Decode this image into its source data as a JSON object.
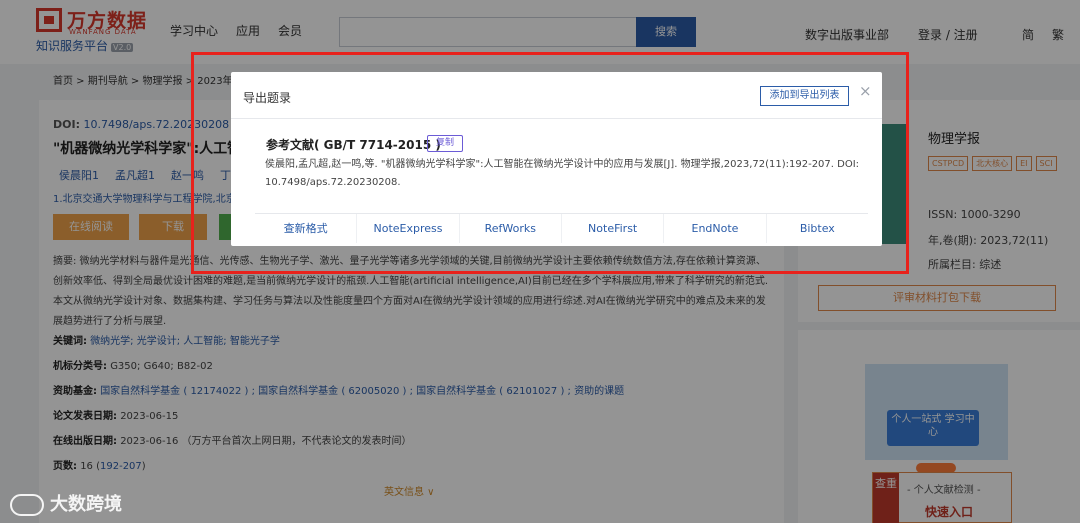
{
  "header": {
    "logo_cn": "万方数据",
    "logo_en": "WANFANG DATA",
    "logo_sub": "知识服务平台",
    "logo_version": "V2.0",
    "nav": [
      "学习中心",
      "应用",
      "会员"
    ],
    "search_button": "搜索",
    "digital_publishing": "数字出版事业部",
    "login": "登录 / 注册",
    "lang_simplified": "简",
    "lang_traditional": "繁"
  },
  "breadcrumb": "首页 > 期刊导航 > 物理学报 > 2023年",
  "article": {
    "doi_label": "DOI:",
    "doi_value": "10.7498/aps.72.20230208",
    "title": "\"机器微纳光学科学家\":人工智",
    "authors": [
      "侯晨阳1",
      "孟凡超1",
      "赵一鸣",
      "丁讯"
    ],
    "affiliation": "1.北京交通大学物理科学与工程学院,北京",
    "btn_read": "在线阅读",
    "btn_download": "下载",
    "abstract": "摘要: 微纳光学材料与器件是光通信、光传感、生物光子学、激光、量子光学等诸多光学领域的关键,目前微纳光学设计主要依赖传统数值方法,存在依赖计算资源、创新效率低、得到全局最优设计困难的难题,是当前微纳光学设计的瓶颈.人工智能(artificial intelligence,AI)目前已经在多个学科展应用,带来了科学研究的新范式.本文从微纳光学设计对象、数据集构建、学习任务与算法以及性能度量四个方面对AI在微纳光学设计领域的应用进行综述.对AI在微纳光学研究中的难点及未来的发展趋势进行了分析与展望.",
    "keywords_label": "关键词:",
    "keywords": "微纳光学; 光学设计; 人工智能; 智能光子学",
    "class_label": "机标分类号:",
    "class_value": "G350; G640; B82-02",
    "fund_label": "资助基金:",
    "fund_value": "国家自然科学基金 ( 12174022 ) ; 国家自然科学基金 ( 62005020 ) ; 国家自然科学基金 ( 62101027 ) ; 资助的课题",
    "pubdate_label": "论文发表日期:",
    "pubdate_value": "2023-06-15",
    "online_label": "在线出版日期:",
    "online_value": "2023-06-16 （万方平台首次上网日期，不代表论文的发表时间）",
    "pages_label": "页数:",
    "pages_value": "16 (",
    "pages_range": "192-207",
    "pages_end": ")",
    "expand": "英文信息 ∨"
  },
  "side": {
    "journal": "物理学报",
    "tags": [
      "CSTPCD",
      "北大核心",
      "EI",
      "SCI"
    ],
    "issn": "ISSN: 1000-3290",
    "volume": "年,卷(期): 2023,72(11)",
    "column": "所属栏目: 综述",
    "pack_download": "评审材料打包下载",
    "promo_text": "个人一站式 学习中心",
    "detect_side": "查重",
    "detect_title": "- 个人文献检测 -",
    "detect_entry": "快速入口"
  },
  "dialog": {
    "title": "导出题录",
    "add_button": "添加到导出列表",
    "close": "×",
    "ref_label": "参考文献( GB/T 7714-2015 )",
    "copy_button": "复制",
    "ref_text": "侯晨阳,孟凡超,赵一鸣,等. \"机器微纳光学科学家\":人工智能在微纳光学设计中的应用与发展[J]. 物理学报,2023,72(11):192-207. DOI:10.7498/aps.72.20230208.",
    "formats": [
      "查新格式",
      "NoteExpress",
      "RefWorks",
      "NoteFirst",
      "EndNote",
      "Bibtex"
    ]
  },
  "watermark": "大数跨境",
  "colors": {
    "brand_red": "#d8382c",
    "brand_blue": "#2b5ca8",
    "highlight_red": "#e8221c",
    "accent_orange": "#f0a34a"
  }
}
